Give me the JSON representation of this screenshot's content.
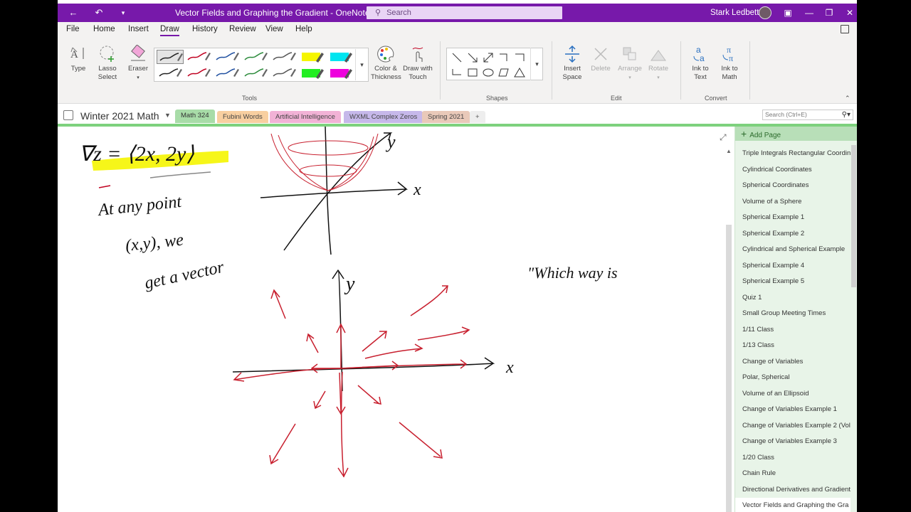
{
  "titlebar": {
    "title": "Vector Fields and Graphing the Gradient  -  OneNote",
    "search_placeholder": "Search",
    "user_name": "Stark Ledbetter"
  },
  "menu": [
    "File",
    "Home",
    "Insert",
    "Draw",
    "History",
    "Review",
    "View",
    "Help"
  ],
  "ribbon": {
    "tools": {
      "type_label": "Type",
      "lasso_label_1": "Lasso",
      "lasso_label_2": "Select",
      "eraser_label": "Eraser",
      "color_label_1": "Color &",
      "color_label_2": "Thickness",
      "touch_label_1": "Draw with",
      "touch_label_2": "Touch",
      "group_label": "Tools"
    },
    "shapes_label": "Shapes",
    "edit": {
      "insert_space_1": "Insert",
      "insert_space_2": "Space",
      "delete": "Delete",
      "arrange": "Arrange",
      "rotate": "Rotate",
      "group_label": "Edit"
    },
    "convert": {
      "ink_text_1": "Ink to",
      "ink_text_2": "Text",
      "ink_math_1": "Ink to",
      "ink_math_2": "Math",
      "group_label": "Convert"
    },
    "pen_colors": [
      "#222222",
      "#c00020",
      "#1f4fa0",
      "#2a8a3a",
      "#555555",
      "#f5f500",
      "#00e5f0",
      "#222222",
      "#c00020",
      "#1f4fa0",
      "#2a8a3a",
      "#555555",
      "#22ee22",
      "#ee00dd"
    ]
  },
  "notebook": {
    "name": "Winter 2021 Math",
    "sections": [
      {
        "label": "Math 324",
        "color": "#a8dca8"
      },
      {
        "label": "Fubini Words",
        "color": "#f8cfa0"
      },
      {
        "label": "Artificial Intelligence",
        "color": "#f2b2d6"
      },
      {
        "label": "WXML Complex Zeros",
        "color": "#c6b8ea"
      },
      {
        "label": "Spring 2021",
        "color": "#e9c9b9"
      }
    ],
    "add_section": "+",
    "search_placeholder": "Search (Ctrl+E)"
  },
  "pages": {
    "add_page": "Add Page",
    "items": [
      "Triple Integrals Rectangular Coordin",
      "Cylindrical Coordinates",
      "Spherical Coordinates",
      "Volume of a Sphere",
      "Spherical Example 1",
      "Spherical Example 2",
      "Cylindrical and Spherical Example",
      "Spherical Example 4",
      "Spherical Example 5",
      "Quiz 1",
      "Small Group Meeting Times",
      "1/11 Class",
      "1/13 Class",
      "Change of Variables",
      "Polar, Spherical",
      "Volume of an Ellipsoid",
      "Change of Variables Example 1",
      "Change of Variables Example 2 (Vol",
      "Change of Variables Example 3",
      "1/20 Class",
      "Chain Rule",
      "Directional Derivatives and Gradient",
      "Vector Fields and Graphing the Gra"
    ]
  },
  "canvas": {
    "ink_gradient": "∇z = ⟨2x, 2y⟩",
    "ink_at_any_point": "At any point",
    "ink_xy_we": "(x,y), we",
    "ink_get_vector": "get a vector",
    "ink_which_way": "\"Which way is",
    "ink_axis_x": "x",
    "ink_axis_y": "y",
    "ink_axis_x2": "x",
    "ink_axis_y2": "y"
  }
}
